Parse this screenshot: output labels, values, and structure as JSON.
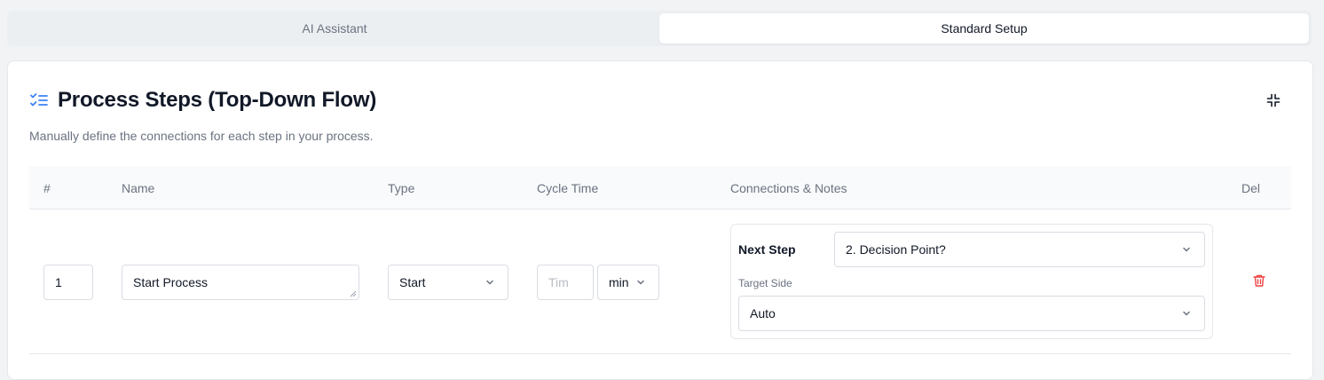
{
  "tabs": [
    {
      "label": "AI Assistant",
      "active": false
    },
    {
      "label": "Standard Setup",
      "active": true
    }
  ],
  "card": {
    "title": "Process Steps (Top-Down Flow)",
    "title_icon": "list-checks-icon",
    "subtitle": "Manually define the connections for each step in your process.",
    "collapse_icon": "minimize-icon"
  },
  "table": {
    "headers": {
      "num": "#",
      "name": "Name",
      "type": "Type",
      "cycle_time": "Cycle Time",
      "connections": "Connections & Notes",
      "del": "Del"
    },
    "rows": [
      {
        "num": "1",
        "name": "Start Process",
        "type": "Start",
        "cycle_time_value": "",
        "cycle_time_placeholder": "Tim",
        "cycle_time_unit": "min",
        "next_step_label": "Next Step",
        "next_step": "2. Decision Point?",
        "target_side_label": "Target Side",
        "target_side": "Auto",
        "delete_icon": "trash-icon"
      }
    ]
  },
  "colors": {
    "accent": "#3b82f6",
    "danger": "#ef4444"
  }
}
